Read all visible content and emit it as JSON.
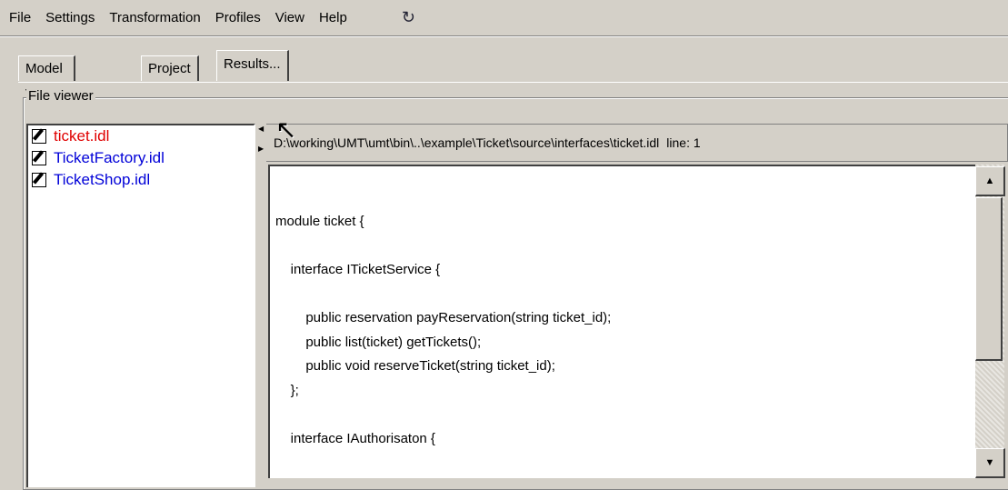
{
  "menu": {
    "items": [
      "File",
      "Settings",
      "Transformation",
      "Profiles",
      "View",
      "Help"
    ],
    "toolbar_icon": "refresh-icon"
  },
  "tabs": [
    "Model Viewer",
    "Project",
    "Results..."
  ],
  "active_tab": "Results...",
  "file_viewer": {
    "title": "File viewer",
    "files": [
      {
        "name": "ticket.idl",
        "color": "#e00000",
        "icon": "edit-file-icon"
      },
      {
        "name": "TicketFactory.idl",
        "color": "#0000d8",
        "icon": "edit-file-icon"
      },
      {
        "name": "TicketShop.idl",
        "color": "#0000d8",
        "icon": "edit-file-icon"
      }
    ],
    "path": "D:\\working\\UMT\\umt\\bin\\..\\example\\Ticket\\source\\interfaces\\ticket.idl",
    "line_label": "line: 1",
    "code": "module ticket {\n\n    interface ITicketService {\n\n        public reservation payReservation(string ticket_id);\n        public list(ticket) getTickets();\n        public void reserveTicket(string ticket_id);\n    };\n\n    interface IAuthorisaton {"
  }
}
